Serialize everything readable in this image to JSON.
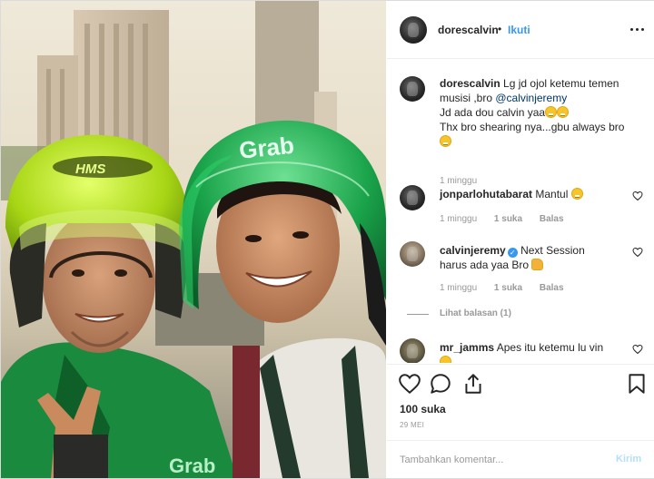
{
  "post": {
    "username": "dorescalvin",
    "separator": "•",
    "follow_label": "Ikuti",
    "caption": {
      "username": "dorescalvin",
      "line1": "Lg jd ojol ketemu temen",
      "line2_pre": "musisi ,bro ",
      "mention": "@calvinjeremy",
      "line3": "Jd ada dou calvin yaa",
      "line4": "Thx bro shearing nya...gbu always bro",
      "time": "1 minggu"
    },
    "comments": [
      {
        "username": "jonparlohutabarat",
        "text": "Mantul",
        "time": "1 minggu",
        "likes": "1 suka",
        "reply": "Balas"
      },
      {
        "username": "calvinjeremy",
        "text": "Next Session",
        "text2": "harus ada yaa Bro",
        "time": "1 minggu",
        "likes": "1 suka",
        "reply": "Balas",
        "verified": true
      },
      {
        "username": "mr_jamms",
        "text": "Apes itu ketemu lu vin"
      }
    ],
    "view_replies": "Lihat balasan (1)",
    "likes_count": "100 suka",
    "date": "29 MEI",
    "comment_placeholder": "Tambahkan komentar...",
    "post_button": "Kirim"
  },
  "photo": {
    "helmet_logo_left": "HMS",
    "helmet_logo_right": "Grab",
    "jacket_logo": "Grab"
  },
  "colors": {
    "link": "#3897f0",
    "grab_green": "#1aa34a",
    "helmet_lime": "#b6e21c"
  },
  "icons": [
    "more-options-icon",
    "heart-icon",
    "comment-icon",
    "share-icon",
    "bookmark-icon",
    "verified-icon"
  ]
}
